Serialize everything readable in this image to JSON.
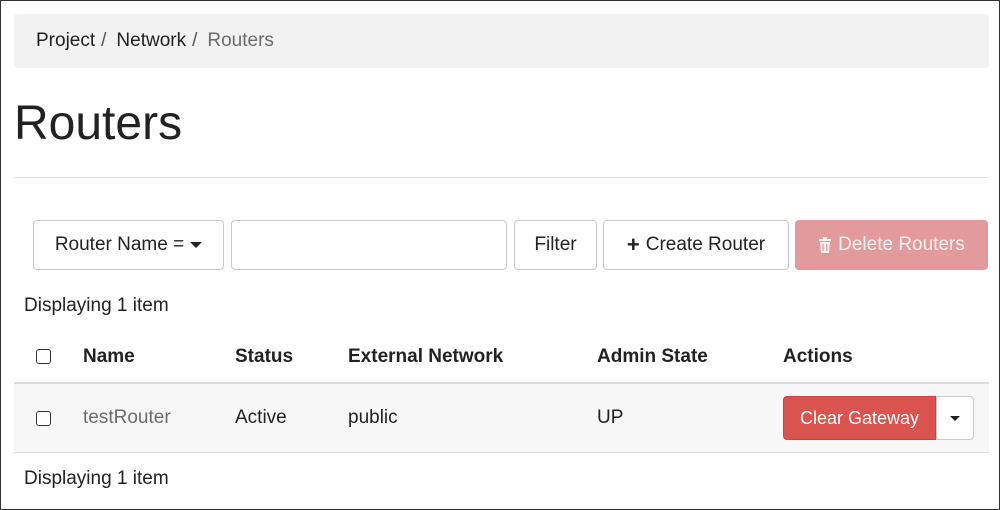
{
  "breadcrumb": {
    "items": [
      "Project",
      "Network",
      "Routers"
    ],
    "separator": "/"
  },
  "page": {
    "title": "Routers"
  },
  "toolbar": {
    "filter_field_label": "Router Name =",
    "filter_input_value": "",
    "filter_button": "Filter",
    "create_button": "Create Router",
    "delete_button": "Delete Routers"
  },
  "table": {
    "count_text": "Displaying 1 item",
    "columns": [
      "Name",
      "Status",
      "External Network",
      "Admin State",
      "Actions"
    ],
    "rows": [
      {
        "name": "testRouter",
        "status": "Active",
        "external_network": "public",
        "admin_state": "UP",
        "action_label": "Clear Gateway"
      }
    ]
  },
  "icons": {
    "create": "plus-icon",
    "delete": "trash-icon",
    "dropdown": "caret-down-icon"
  },
  "colors": {
    "danger": "#d9534f",
    "danger_disabled": "#e39a9c",
    "breadcrumb_bg": "#f2f2f2"
  }
}
